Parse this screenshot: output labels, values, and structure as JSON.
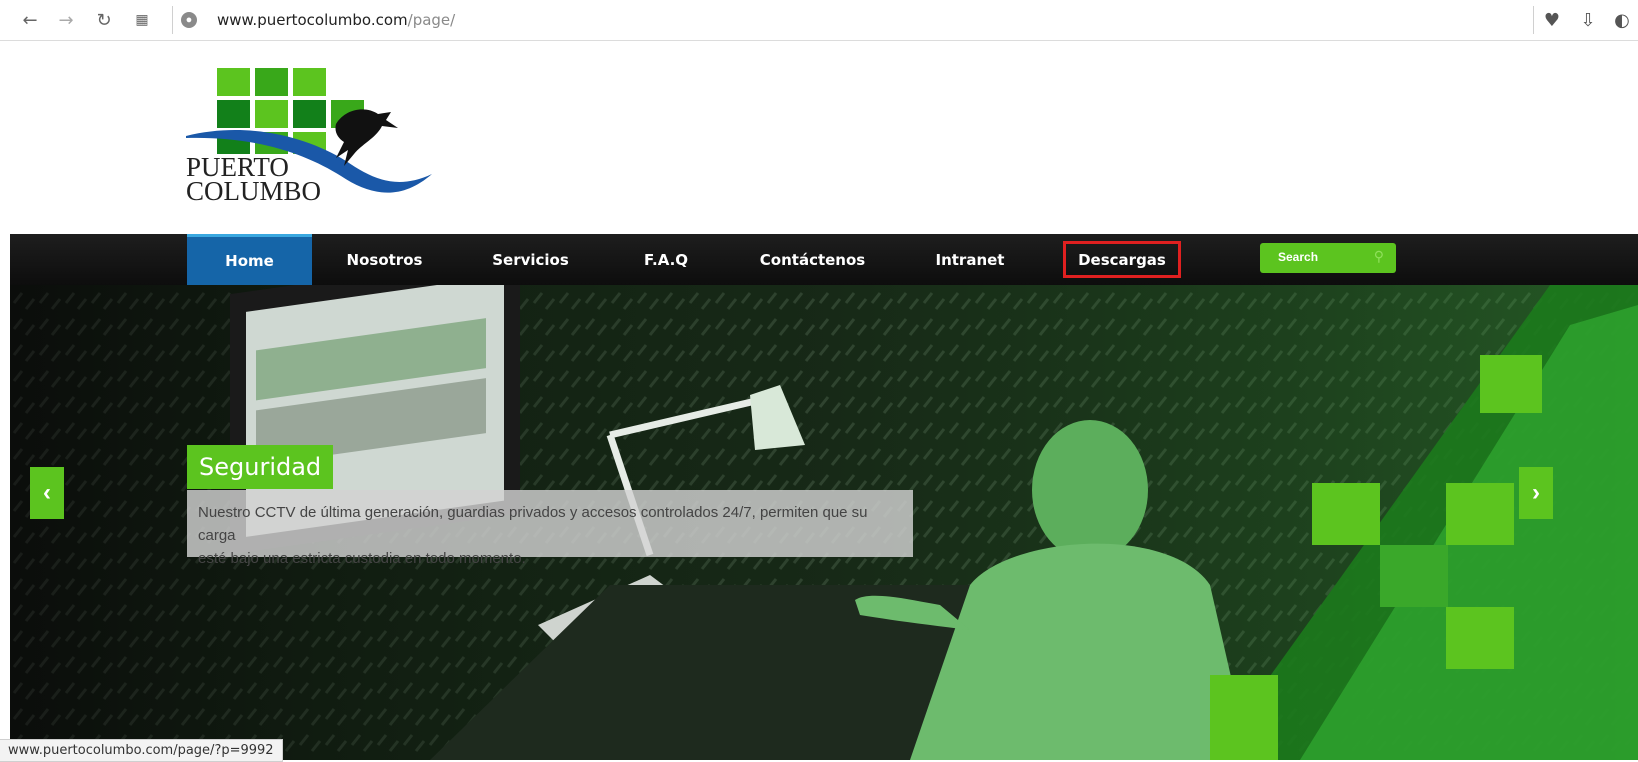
{
  "browser": {
    "url_host": "www.puertocolumbo.com",
    "url_path": "/page/"
  },
  "logo": {
    "line1": "PUERTO",
    "line2": "COLUMBO"
  },
  "nav": {
    "items": [
      "Home",
      "Nosotros",
      "Servicios",
      "F.A.Q",
      "Contáctenos",
      "Intranet",
      "Descargas"
    ],
    "search_label": "Search"
  },
  "hero": {
    "caption_title": "Seguridad",
    "caption_text_line1": "Nuestro CCTV de última generación, guardias privados y accesos controlados 24/7, permiten que su carga",
    "caption_text_line2": "esté bajo una estricta custodia en todo momento."
  },
  "status_url": "www.puertocolumbo.com/page/?p=9992",
  "colors": {
    "accent_green": "#5cc41f",
    "nav_active": "#1565a8",
    "highlight": "#e02020"
  }
}
